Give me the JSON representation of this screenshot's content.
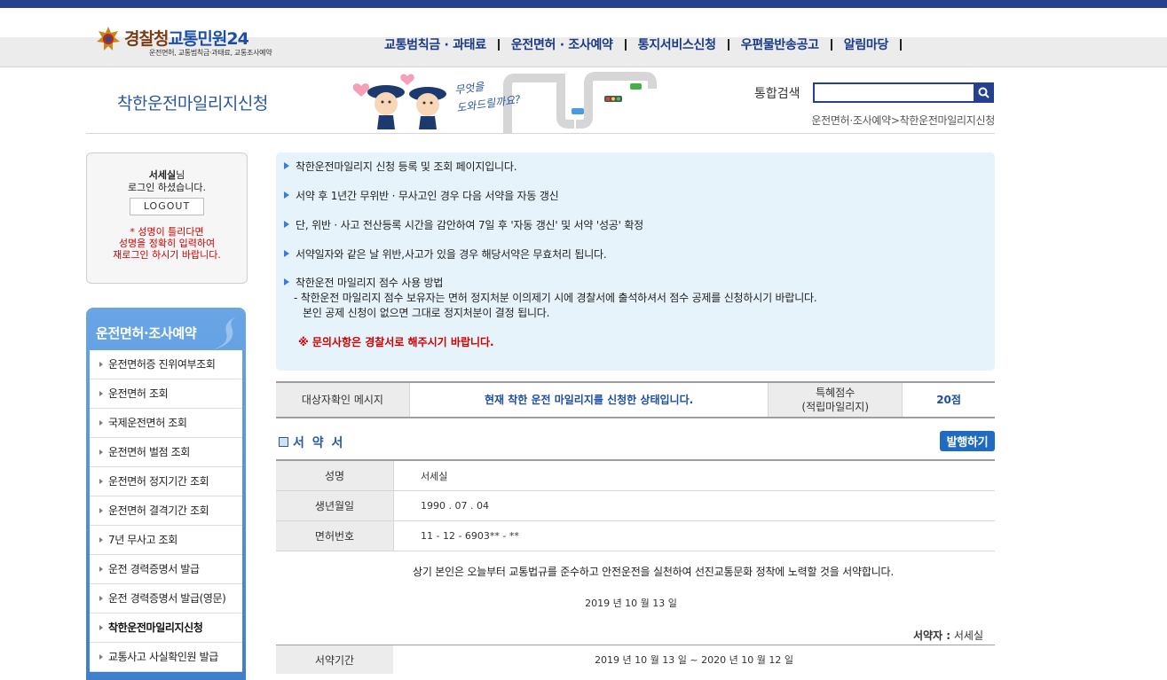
{
  "brand": {
    "name_part1": "경찰청",
    "name_part2": "교통민원24",
    "subtitle": "운전면허, 교통범칙금·과태료, 교통조사예약"
  },
  "gnb": {
    "items": [
      {
        "label": "교통범칙금 · 과태료"
      },
      {
        "label": "운전면허 · 조사예약"
      },
      {
        "label": "통지서비스신청"
      },
      {
        "label": "우편물반송공고"
      },
      {
        "label": "알림마당"
      }
    ]
  },
  "header": {
    "page_title": "착한운전마일리지신청",
    "banner_text_line1": "무엇을",
    "banner_text_line2": "도와드릴까요?",
    "search_label": "통합검색",
    "search_value": "",
    "breadcrumb": "운전면허·조사예약>착한운전마일리지신청"
  },
  "login": {
    "user_name": "서세실",
    "user_suffix": "님",
    "logged_in_text": "로그인 하셨습니다.",
    "logout_label": "LOGOUT",
    "warning_line1": "* 성명이 틀리다면",
    "warning_line2": "성명을 정확히 입력하여",
    "warning_line3": "재로그인 하시기 바랍니다."
  },
  "lnb": {
    "title": "운전면허·조사예약",
    "items": [
      {
        "label": "운전면허증 진위여부조회"
      },
      {
        "label": "운전면허 조회"
      },
      {
        "label": "국제운전면허 조회"
      },
      {
        "label": "운전면허 벌점 조회"
      },
      {
        "label": "운전면허 정지기간 조회"
      },
      {
        "label": "운전면허 결격기간 조회"
      },
      {
        "label": "7년 무사고 조회"
      },
      {
        "label": "운전 경력증명서 발급"
      },
      {
        "label": "운전 경력증명서 발급(영문)"
      },
      {
        "label": "착한운전마일리지신청"
      },
      {
        "label": "교통사고 사실확인원 발급"
      }
    ]
  },
  "notice": {
    "line1": "착한운전마일리지 신청 등록 및 조회 페이지입니다.",
    "line2": "서약 후 1년간 무위반 · 무사고인 경우 다음 서약을 자동 갱신",
    "line3": "단, 위반 · 사고 전산등록 시간을 감안하여 7일 후 '자동 갱신' 및 서약 '성공' 확정",
    "line4": "서약일자와 같은 날 위반,사고가 있을 경우 해당서약은 무효처리 됩니다.",
    "line5": "착한운전 마일리지 점수 사용 방법",
    "line5_sub1": "- 착한운전 마일리지 점수 보유자는 면허 정지처분 이의제기 시에 경찰서에 출석하셔서 점수 공제를 신청하시기 바랍니다.",
    "line5_sub2": "본인 공제 신청이 없으면 그대로 정지처분이 결정 됩니다.",
    "inquiry": "※ 문의사항은 경찰서로 해주시기 바랍니다."
  },
  "status": {
    "label": "대상자확인 메시지",
    "message": "현재 착한 운전 마일리지를 신청한 상태입니다.",
    "points_label_line1": "특혜점수",
    "points_label_line2": "(적립마일리지)",
    "points_value": "20점"
  },
  "pledge": {
    "section_title": "서 약 서",
    "issue_button": "발행하기",
    "rows": [
      {
        "key": "성명",
        "value": "서세실"
      },
      {
        "key": "생년월일",
        "value": "1990 . 07 . 04"
      },
      {
        "key": "면허번호",
        "value": "11 - 12 - 6903** - **"
      }
    ],
    "statement": "상기 본인은 오늘부터 교통법규를 준수하고 안전운전을 실천하여 선진교통문화 정착에 노력할 것을 서약합니다.",
    "date": "2019 년 10 월 13 일",
    "signer_label": "서약자 :",
    "signer_name": "서세실",
    "period_label": "서약기간",
    "period_value": "2019 년 10 월 13 일 ~ 2020 년 10 월 12 일"
  },
  "colors": {
    "brand_blue": "#24408e",
    "link_blue": "#1d4ea6",
    "warning_red": "#d10000",
    "notice_bg": "#e6f3fa"
  }
}
